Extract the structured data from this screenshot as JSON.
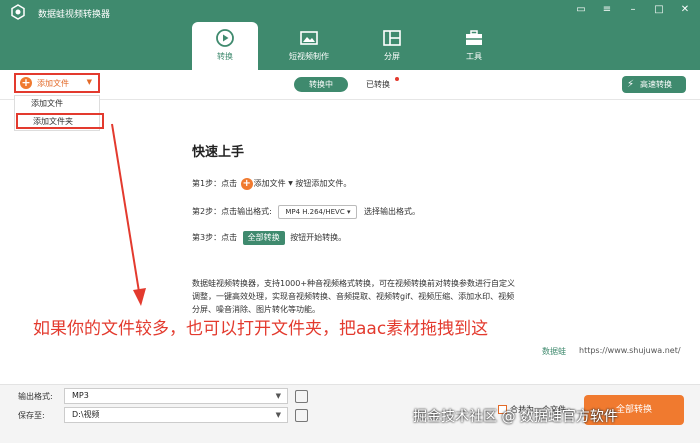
{
  "app": {
    "title": "数据蛙视频转换器"
  },
  "window_controls": [
    "message-icon",
    "menu-icon",
    "minimize-icon",
    "maximize-icon",
    "close-icon"
  ],
  "tabs": [
    {
      "label": "转换",
      "icon": "convert-icon",
      "active": true
    },
    {
      "label": "短视频制作",
      "icon": "short-video-icon",
      "active": false
    },
    {
      "label": "分屏",
      "icon": "split-screen-icon",
      "active": false
    },
    {
      "label": "工具",
      "icon": "toolbox-icon",
      "active": false
    }
  ],
  "toolbar": {
    "add_file_label": "添加文件",
    "dropdown_items": [
      "添加文件",
      "添加文件夹"
    ],
    "converting_label": "转换中",
    "converted_label": "已转换",
    "high_speed_label": "高速转换"
  },
  "guide": {
    "title": "快速上手",
    "step1_prefix": "第1步：点击",
    "step1_btn": "添加文件",
    "step1_suffix": "按钮添加文件。",
    "step2_prefix": "第2步：点击输出格式:",
    "step2_format": "MP4 H.264/HEVC",
    "step2_suffix": "选择输出格式。",
    "step3_prefix": "第3步：点击",
    "step3_btn": "全部转换",
    "step3_suffix": "按钮开始转换。",
    "description": "数据蛙视频转换器，支持1000+种音视频格式转换，可在视频转换前对转换参数进行自定义调整，一键高效处理，实现音视频转换、音频提取、视频转gif、视频压缩、添加水印、视频分屏、噪音消除、图片转化等功能。"
  },
  "annotation": "如果你的文件较多，也可以打开文件夹，把aac素材拖拽到这",
  "brand": {
    "mark": "数据蛙",
    "url": "https://www.shujuwa.net/"
  },
  "bottom": {
    "output_format_label": "输出格式:",
    "output_format_value": "MP3",
    "save_to_label": "保存至:",
    "save_to_value": "D:\\视频",
    "merge_label": "合并为一个文件",
    "convert_all_label": "全部转换"
  },
  "watermark": "掘金技术社区 @ 数据蛙官方软件",
  "colors": {
    "accent": "#3f8a6e",
    "orange": "#f07a2f",
    "red": "#e33a2e"
  }
}
